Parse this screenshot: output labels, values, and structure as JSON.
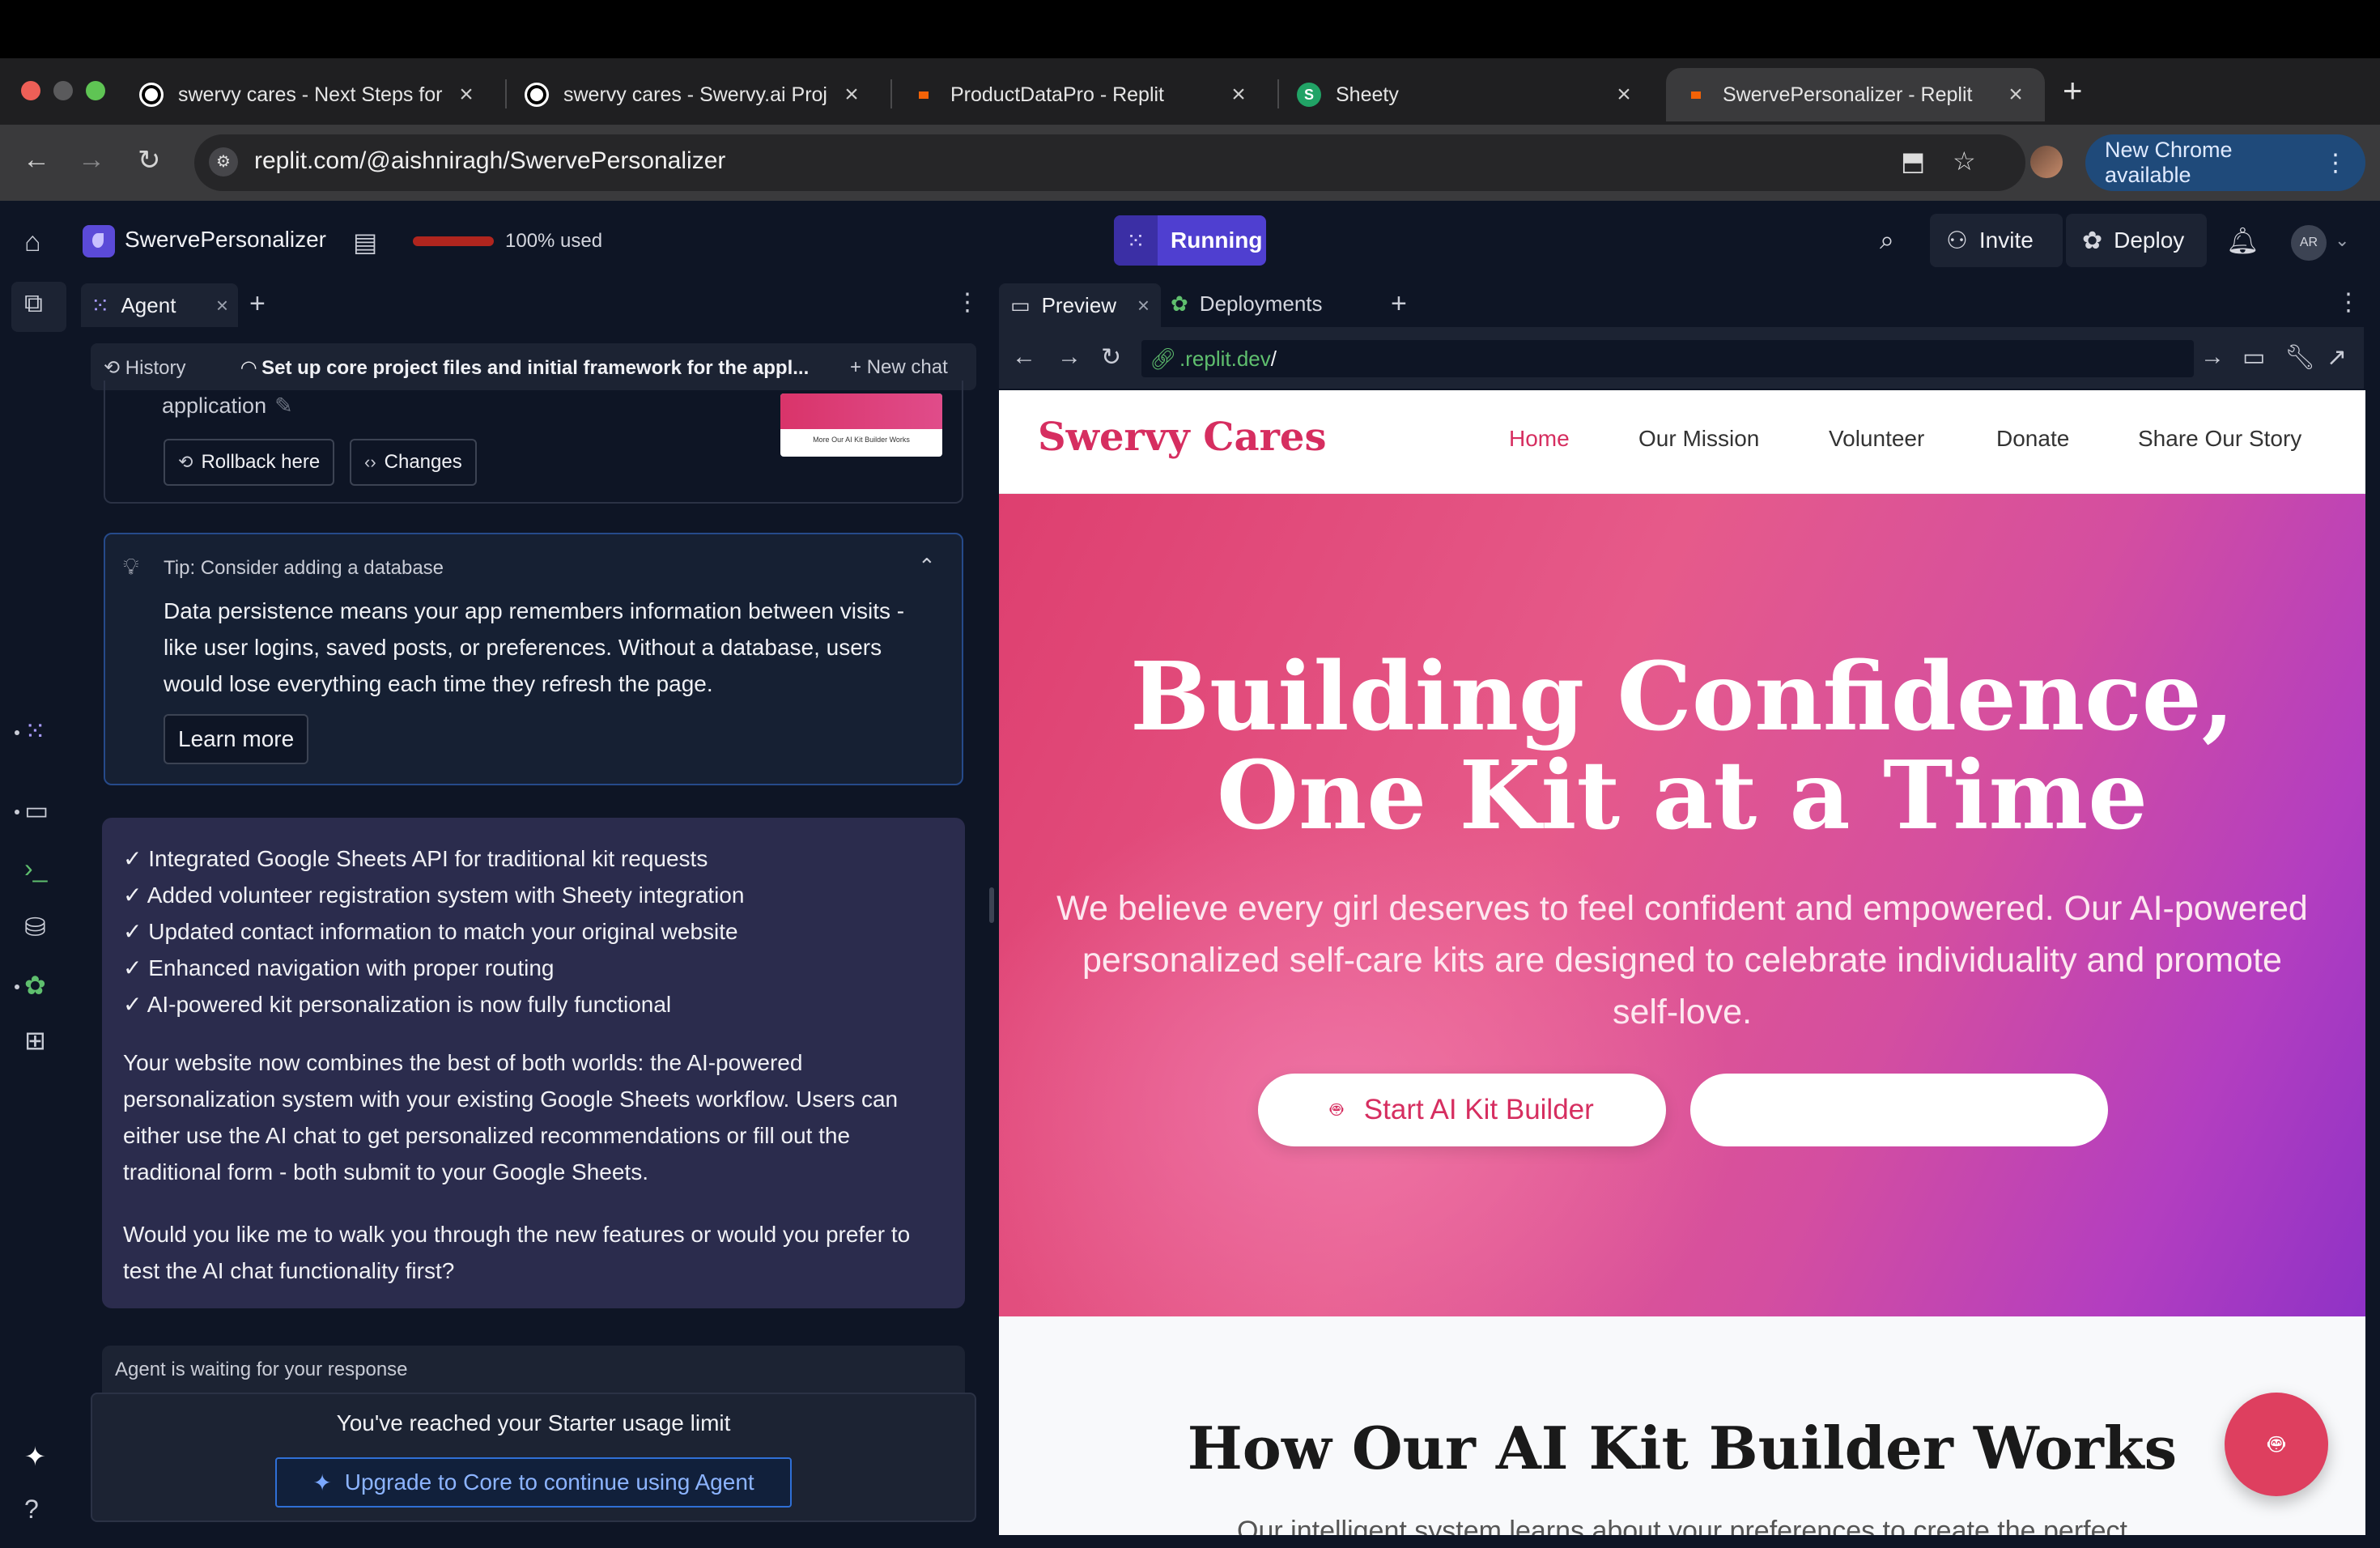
{
  "browser": {
    "tabs": [
      {
        "title": "swervy cares - Next Steps for",
        "favicon": "openai-icon"
      },
      {
        "title": "swervy cares - Swervy.ai Proj",
        "favicon": "openai-icon"
      },
      {
        "title": "ProductDataPro - Replit",
        "favicon": "replit-icon"
      },
      {
        "title": "Sheety",
        "favicon": "sheety-icon"
      },
      {
        "title": "SwervePersonalizer - Replit",
        "favicon": "replit-icon",
        "active": true
      }
    ],
    "url": "replit.com/@aishniragh/SwervePersonalizer",
    "update_label": "New Chrome available"
  },
  "replit": {
    "project_name": "SwervePersonalizer",
    "usage_text": "100% used",
    "run_status": "Running",
    "invite_label": "Invite",
    "deploy_label": "Deploy",
    "user_initials": "AR"
  },
  "agent": {
    "tab_label": "Agent",
    "history_label": "History",
    "chat_title": "Set up core project files and initial framework for the appl...",
    "new_chat_label": "New chat",
    "prev_checkpoint_text": "application",
    "thumb_text": "More Our AI Kit Builder Works",
    "rollback_label": "Rollback here",
    "changes_label": "Changes",
    "tip": {
      "heading": "Tip: Consider adding a database",
      "body": "Data persistence means your app remembers information between visits - like user logins, saved posts, or preferences. Without a database, users would lose everything each time they refresh the page.",
      "learn_more": "Learn more"
    },
    "message": {
      "items": [
        "✓ Integrated Google Sheets API for traditional kit requests",
        "✓ Added volunteer registration system with Sheety integration",
        "✓ Updated contact information to match your original website",
        "✓ Enhanced navigation with proper routing",
        "✓ AI-powered kit personalization is now fully functional"
      ],
      "para1": "Your website now combines the best of both worlds: the AI-powered personalization system with your existing Google Sheets workflow. Users can either use the AI chat to get personalized recommendations or fill out the traditional form - both submit to your Google Sheets.",
      "para2": "Would you like me to walk you through the new features or would you prefer to test the AI chat functionality first?"
    },
    "waiting_text": "Agent is waiting for your response",
    "limit_text": "You've reached your Starter usage limit",
    "upgrade_label": "Upgrade to Core to continue using Agent"
  },
  "preview": {
    "tab_label": "Preview",
    "deployments_label": "Deployments",
    "url_domain": ".replit.dev",
    "url_path": "/"
  },
  "site": {
    "logo": "Swervy Cares",
    "nav": [
      "Home",
      "Our Mission",
      "Volunteer",
      "Donate",
      "Share Our Story"
    ],
    "hero_title_line1": "Building Confidence,",
    "hero_title_line2": "One Kit at a Time",
    "hero_sub": "We believe every girl deserves to feel confident and empowered. Our AI-powered personalized self-care kits are designed to celebrate individuality and promote self-love.",
    "cta_primary": "Start AI Kit Builder",
    "cta_secondary": "",
    "section_title": "How Our AI Kit Builder Works",
    "section_sub": "Our intelligent system learns about your preferences to create the perfect"
  },
  "colors": {
    "brand_pink": "#d62e60",
    "replit_bg": "#0e1525",
    "running_purple": "#4f3fd0"
  }
}
